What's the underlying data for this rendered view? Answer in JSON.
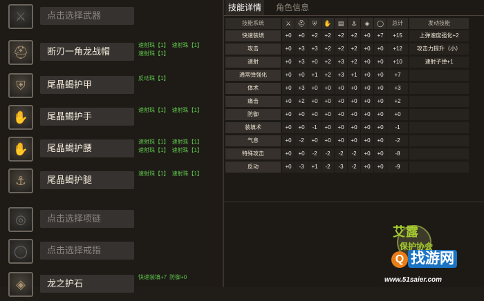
{
  "equipment": [
    {
      "name": "点击选择武器",
      "icon": "sword-icon",
      "empty": true,
      "skills": []
    },
    {
      "name": "断刃一角龙战帽",
      "icon": "helmet-icon",
      "empty": false,
      "skills": [
        "速射珠【1】",
        "速射珠【1】",
        "速射珠【1】"
      ]
    },
    {
      "name": "尾晶蝎护甲",
      "icon": "chest-armor-icon",
      "empty": false,
      "skills": [
        "反动珠【1】"
      ]
    },
    {
      "name": "尾晶蝎护手",
      "icon": "gauntlet-icon",
      "empty": false,
      "skills": [
        "速射珠【1】",
        "速射珠【1】"
      ]
    },
    {
      "name": "尾晶蝎护腰",
      "icon": "waist-armor-icon",
      "empty": false,
      "skills": [
        "速射珠【1】",
        "速射珠【1】",
        "速射珠【1】",
        "速射珠【1】"
      ]
    },
    {
      "name": "尾晶蝎护腿",
      "icon": "leg-armor-icon",
      "empty": false,
      "skills": [
        "速射珠【1】",
        "速射珠【1】"
      ]
    },
    {
      "name": "点击选择项链",
      "icon": "necklace-icon",
      "empty": true,
      "skills": []
    },
    {
      "name": "点击选择戒指",
      "icon": "ring-icon",
      "empty": true,
      "skills": []
    },
    {
      "name": "龙之护石",
      "icon": "charm-icon",
      "empty": false,
      "skills": [
        "快速装填+7",
        "防御+0"
      ]
    }
  ],
  "tabs": {
    "active": "技能详情",
    "inactive": "角色信息"
  },
  "grid": {
    "header": {
      "system": "技能系统",
      "icons": [
        "weapon-col-icon",
        "helmet-col-icon",
        "chest-col-icon",
        "gauntlet-col-icon",
        "waist-col-icon",
        "leg-col-icon",
        "charm-col-icon",
        "ring-col-icon"
      ],
      "total": "总计",
      "effect": "发动技能"
    },
    "rows": [
      {
        "name": "快速装填",
        "vals": [
          "+0",
          "+0",
          "+2",
          "+2",
          "+2",
          "+2",
          "+0",
          "+7"
        ],
        "total": "+15",
        "effect": "上弹速度强化+2"
      },
      {
        "name": "攻击",
        "vals": [
          "+0",
          "+3",
          "+3",
          "+2",
          "+2",
          "+2",
          "+0",
          "+0"
        ],
        "total": "+12",
        "effect": "攻击力提升（小）"
      },
      {
        "name": "速射",
        "vals": [
          "+0",
          "+3",
          "+0",
          "+2",
          "+3",
          "+2",
          "+0",
          "+0"
        ],
        "total": "+10",
        "effect": "速射子弹+1"
      },
      {
        "name": "通常弹强化",
        "vals": [
          "+0",
          "+0",
          "+1",
          "+2",
          "+3",
          "+1",
          "+0",
          "+0"
        ],
        "total": "+7",
        "effect": ""
      },
      {
        "name": "体术",
        "vals": [
          "+0",
          "+3",
          "+0",
          "+0",
          "+0",
          "+0",
          "+0",
          "+0"
        ],
        "total": "+3",
        "effect": ""
      },
      {
        "name": "痛击",
        "vals": [
          "+0",
          "+2",
          "+0",
          "+0",
          "+0",
          "+0",
          "+0",
          "+0"
        ],
        "total": "+2",
        "effect": ""
      },
      {
        "name": "防御",
        "vals": [
          "+0",
          "+0",
          "+0",
          "+0",
          "+0",
          "+0",
          "+0",
          "+0"
        ],
        "total": "+0",
        "effect": ""
      },
      {
        "name": "装填术",
        "vals": [
          "+0",
          "+0",
          "-1",
          "+0",
          "+0",
          "+0",
          "+0",
          "+0"
        ],
        "total": "-1",
        "effect": ""
      },
      {
        "name": "气息",
        "vals": [
          "+0",
          "-2",
          "+0",
          "+0",
          "+0",
          "+0",
          "+0",
          "+0"
        ],
        "total": "-2",
        "effect": ""
      },
      {
        "name": "特殊攻击",
        "vals": [
          "+0",
          "+0",
          "-2",
          "-2",
          "-2",
          "-2",
          "+0",
          "+0"
        ],
        "total": "-8",
        "effect": ""
      },
      {
        "name": "反动",
        "vals": [
          "+0",
          "-3",
          "+1",
          "-2",
          "-3",
          "-2",
          "+0",
          "+0"
        ],
        "total": "-9",
        "effect": ""
      }
    ]
  },
  "watermark": {
    "line1": "艾露",
    "line2": "保护协会",
    "brand": "找游网",
    "q": "Q",
    "url": "www.51saier.com"
  }
}
